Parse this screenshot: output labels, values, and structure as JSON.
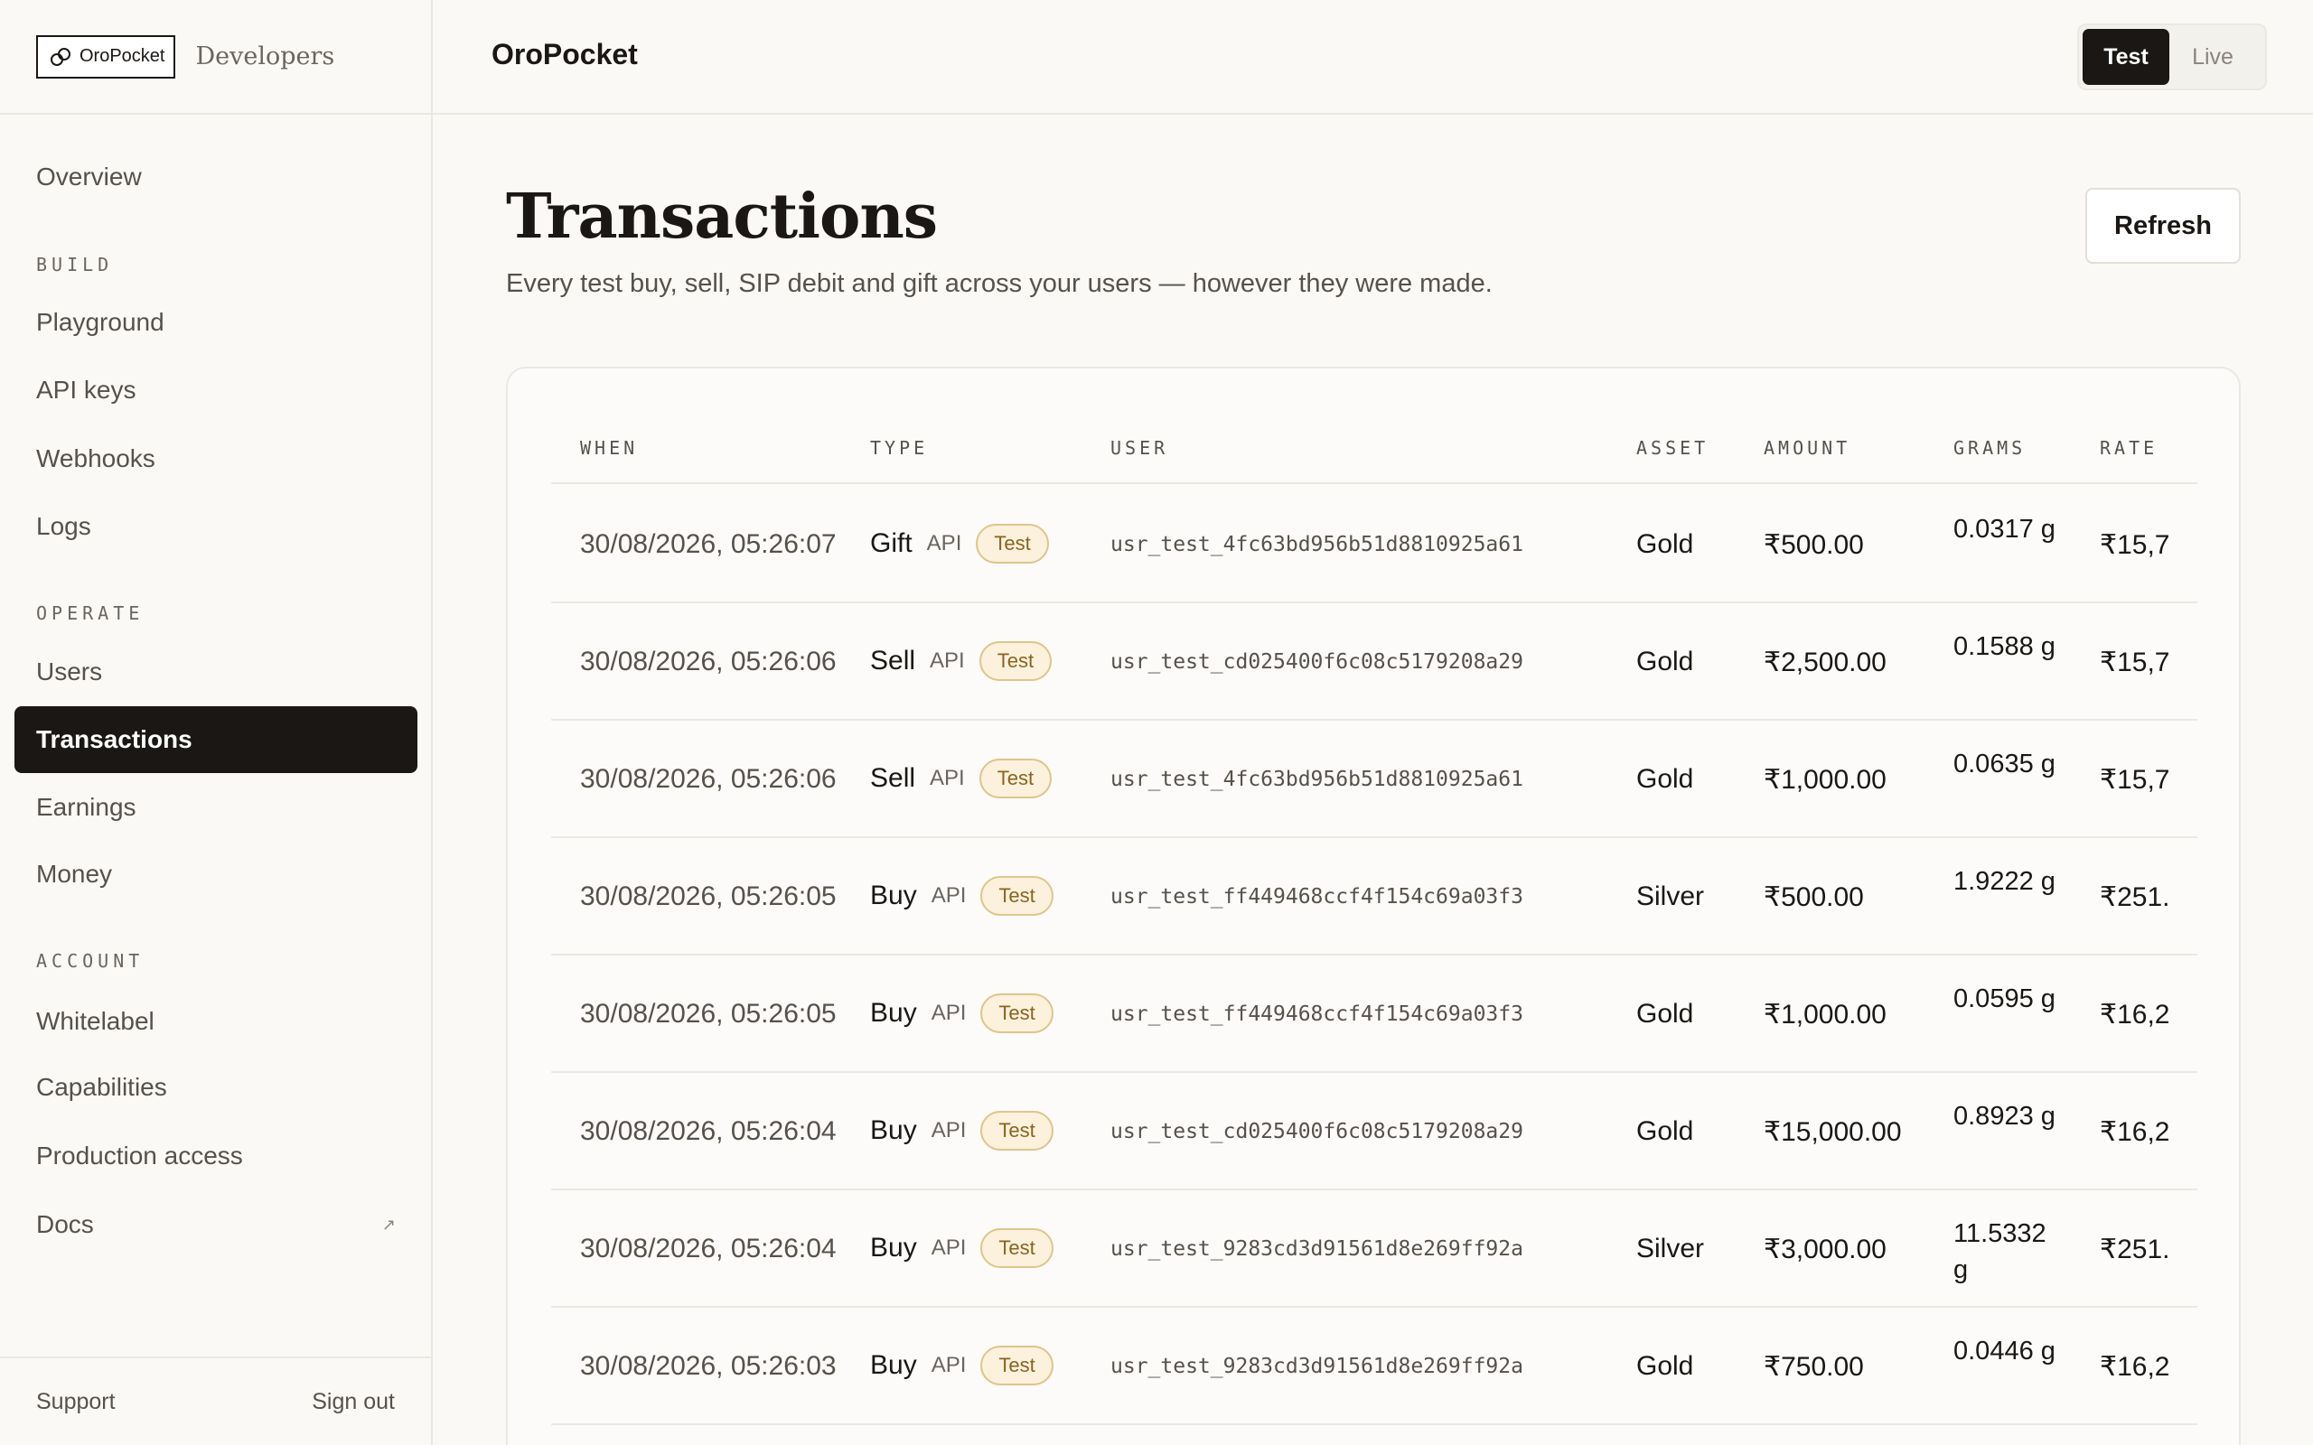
{
  "brand": {
    "logo_text": "OroPocket",
    "developers_label": "Developers"
  },
  "topbar": {
    "title": "OroPocket",
    "modes": [
      "Test",
      "Live"
    ],
    "active_mode": "Test"
  },
  "sidebar": {
    "overview": "Overview",
    "sections": [
      {
        "title": "BUILD",
        "items": [
          "Playground",
          "API keys",
          "Webhooks",
          "Logs"
        ]
      },
      {
        "title": "OPERATE",
        "items": [
          "Users",
          "Transactions",
          "Earnings",
          "Money"
        ]
      },
      {
        "title": "ACCOUNT",
        "items": [
          "Whitelabel",
          "Capabilities",
          "Production access",
          "Docs"
        ]
      }
    ],
    "active_item": "Transactions",
    "docs_external_glyph": "↗",
    "footer": {
      "support": "Support",
      "sign_out": "Sign out"
    }
  },
  "page": {
    "title": "Transactions",
    "subtitle": "Every test buy, sell, SIP debit and gift across your users — however they were made.",
    "refresh_label": "Refresh"
  },
  "table": {
    "columns": [
      "WHEN",
      "TYPE",
      "USER",
      "ASSET",
      "AMOUNT",
      "GRAMS",
      "RATE"
    ],
    "rows": [
      {
        "when": "30/08/2026, 05:26:07",
        "type": "Gift",
        "source": "API",
        "badge": "Test",
        "user": "usr_test_4fc63bd956b51d8810925a61",
        "asset": "Gold",
        "amount": "₹500.00",
        "grams": "0.0317 g",
        "rate": "₹15,7"
      },
      {
        "when": "30/08/2026, 05:26:06",
        "type": "Sell",
        "source": "API",
        "badge": "Test",
        "user": "usr_test_cd025400f6c08c5179208a29",
        "asset": "Gold",
        "amount": "₹2,500.00",
        "grams": "0.1588 g",
        "rate": "₹15,7"
      },
      {
        "when": "30/08/2026, 05:26:06",
        "type": "Sell",
        "source": "API",
        "badge": "Test",
        "user": "usr_test_4fc63bd956b51d8810925a61",
        "asset": "Gold",
        "amount": "₹1,000.00",
        "grams": "0.0635 g",
        "rate": "₹15,7"
      },
      {
        "when": "30/08/2026, 05:26:05",
        "type": "Buy",
        "source": "API",
        "badge": "Test",
        "user": "usr_test_ff449468ccf4f154c69a03f3",
        "asset": "Silver",
        "amount": "₹500.00",
        "grams": "1.9222 g",
        "rate": "₹251."
      },
      {
        "when": "30/08/2026, 05:26:05",
        "type": "Buy",
        "source": "API",
        "badge": "Test",
        "user": "usr_test_ff449468ccf4f154c69a03f3",
        "asset": "Gold",
        "amount": "₹1,000.00",
        "grams": "0.0595 g",
        "rate": "₹16,2"
      },
      {
        "when": "30/08/2026, 05:26:04",
        "type": "Buy",
        "source": "API",
        "badge": "Test",
        "user": "usr_test_cd025400f6c08c5179208a29",
        "asset": "Gold",
        "amount": "₹15,000.00",
        "grams": "0.8923 g",
        "rate": "₹16,2"
      },
      {
        "when": "30/08/2026, 05:26:04",
        "type": "Buy",
        "source": "API",
        "badge": "Test",
        "user": "usr_test_9283cd3d91561d8e269ff92a",
        "asset": "Silver",
        "amount": "₹3,000.00",
        "grams": "11.5332 g",
        "rate": "₹251."
      },
      {
        "when": "30/08/2026, 05:26:03",
        "type": "Buy",
        "source": "API",
        "badge": "Test",
        "user": "usr_test_9283cd3d91561d8e269ff92a",
        "asset": "Gold",
        "amount": "₹750.00",
        "grams": "0.0446 g",
        "rate": "₹16,2"
      }
    ]
  },
  "colors": {
    "background": "#faf9f6",
    "active_nav": "#1a1714",
    "badge_bg": "#fbf1dc",
    "badge_border": "#e0c48a"
  }
}
